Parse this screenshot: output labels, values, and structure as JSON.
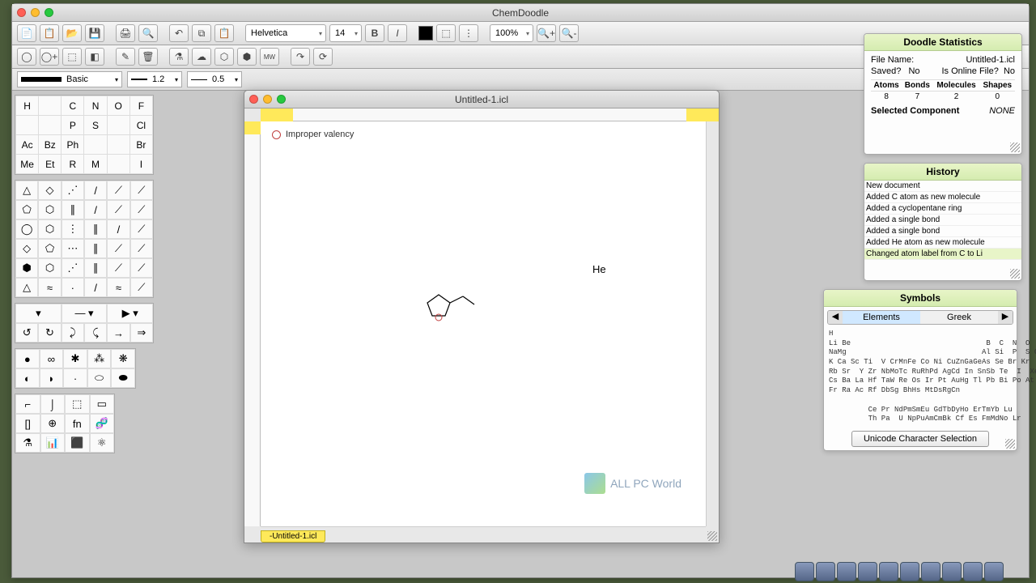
{
  "app": {
    "title": "ChemDoodle"
  },
  "toolbar": {
    "font": "Helvetica",
    "fontsize": "14",
    "bold": "B",
    "italic": "I",
    "zoom": "100%",
    "basic_label": "Basic",
    "lw1": "1.2",
    "lw2": "0.5"
  },
  "elements": {
    "rows": [
      [
        "H",
        "",
        "C",
        "N",
        "O",
        "F"
      ],
      [
        "",
        "",
        "P",
        "S",
        "",
        "Cl"
      ],
      [
        "Ac",
        "Bz",
        "Ph",
        "",
        "",
        "Br"
      ],
      [
        "Me",
        "Et",
        "R",
        "M",
        "",
        "I"
      ]
    ]
  },
  "document": {
    "title": "Untitled-1.icl",
    "tab": "-Untitled-1.icl",
    "warning": "Improper valency",
    "atom_label": "He"
  },
  "stats": {
    "title": "Doodle Statistics",
    "filename_k": "File Name:",
    "filename_v": "Untitled-1.icl",
    "saved_k": "Saved?",
    "saved_v": "No",
    "online_k": "Is Online File?",
    "online_v": "No",
    "cols": [
      "Atoms",
      "Bonds",
      "Molecules",
      "Shapes"
    ],
    "vals": [
      "8",
      "7",
      "2",
      "0"
    ],
    "selcomp_k": "Selected Component",
    "selcomp_v": "NONE"
  },
  "history": {
    "title": "History",
    "items": [
      "New document",
      "Added C atom as new molecule",
      "Added a cyclopentane ring",
      "Added a single bond",
      "Added a single bond",
      "Added He atom as new molecule",
      "Changed atom label from C to Li"
    ]
  },
  "symbols": {
    "title": "Symbols",
    "tab1": "Elements",
    "tab2": "Greek",
    "rows": [
      "H                                                  He",
      "Li Be                               B  C  N  O  F  Ne",
      "NaMg                               Al Si  P  S Cl  Ar",
      "K Ca Sc Ti  V CrMnFe Co Ni CuZnGaGeAs Se Br Kr",
      "Rb Sr  Y Zr NbMoTc RuRhPd AgCd In SnSb Te  I  Xe",
      "Cs Ba La Hf TaW Re Os Ir Pt AuHg Tl Pb Bi Po At Rn",
      "Fr Ra Ac Rf DbSg BhHs MtDsRgCn",
      "",
      "         Ce Pr NdPmSmEu GdTbDyHo ErTmYb Lu",
      "         Th Pa  U NpPuAmCmBk Cf Es FmMdNo Lr"
    ],
    "unicode_btn": "Unicode Character Selection"
  },
  "watermark": "ALL PC World"
}
